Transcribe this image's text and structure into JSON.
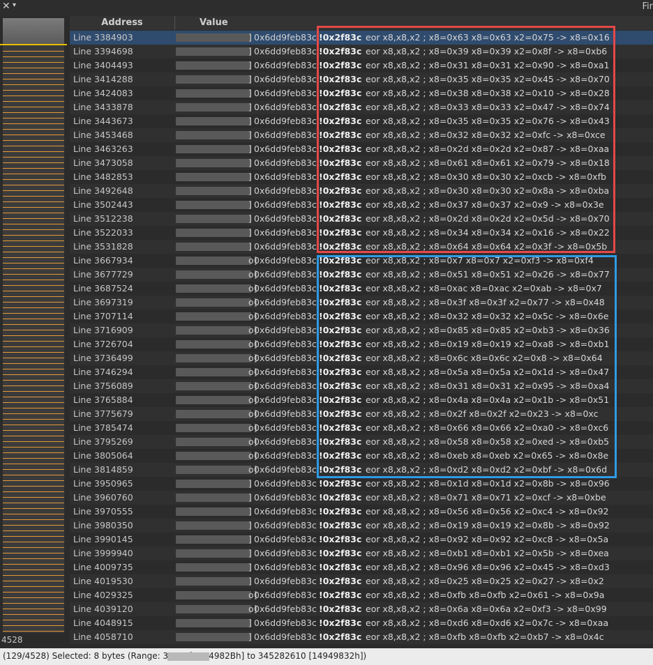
{
  "topbar": {
    "close_icon": "✕",
    "menu_icon": "▾",
    "find_label": "Fir"
  },
  "minimap": {
    "count": "4528"
  },
  "headers": {
    "address": "Address",
    "value": "Value"
  },
  "rows": [
    {
      "line": "Line 3384903",
      "sep": "]",
      "addr": "0x6dd9feb83c",
      "off": "!0x2f83c",
      "op": "eor x8,x8,x2 ; x8=0x63 x8=0x63 x2=0x75 -> x8=0x16"
    },
    {
      "line": "Line 3394698",
      "sep": "]",
      "addr": "0x6dd9feb83c",
      "off": "!0x2f83c",
      "op": "eor x8,x8,x2 ; x8=0x39 x8=0x39 x2=0x8f -> x8=0xb6"
    },
    {
      "line": "Line 3404493",
      "sep": "]",
      "addr": "0x6dd9feb83c",
      "off": "!0x2f83c",
      "op": "eor x8,x8,x2 ; x8=0x31 x8=0x31 x2=0x90 -> x8=0xa1"
    },
    {
      "line": "Line 3414288",
      "sep": "]",
      "addr": "0x6dd9feb83c",
      "off": "!0x2f83c",
      "op": "eor x8,x8,x2 ; x8=0x35 x8=0x35 x2=0x45 -> x8=0x70"
    },
    {
      "line": "Line 3424083",
      "sep": "]",
      "addr": "0x6dd9feb83c",
      "off": "!0x2f83c",
      "op": "eor x8,x8,x2 ; x8=0x38 x8=0x38 x2=0x10 -> x8=0x28"
    },
    {
      "line": "Line 3433878",
      "sep": "]",
      "addr": "0x6dd9feb83c",
      "off": "!0x2f83c",
      "op": "eor x8,x8,x2 ; x8=0x33 x8=0x33 x2=0x47 -> x8=0x74"
    },
    {
      "line": "Line 3443673",
      "sep": "]",
      "addr": "0x6dd9feb83c",
      "off": "!0x2f83c",
      "op": "eor x8,x8,x2 ; x8=0x35 x8=0x35 x2=0x76 -> x8=0x43"
    },
    {
      "line": "Line 3453468",
      "sep": "]",
      "addr": "0x6dd9feb83c",
      "off": "!0x2f83c",
      "op": "eor x8,x8,x2 ; x8=0x32 x8=0x32 x2=0xfc -> x8=0xce"
    },
    {
      "line": "Line 3463263",
      "sep": "]",
      "addr": "0x6dd9feb83c",
      "off": "!0x2f83c",
      "op": "eor x8,x8,x2 ; x8=0x2d x8=0x2d x2=0x87 -> x8=0xaa"
    },
    {
      "line": "Line 3473058",
      "sep": "]",
      "addr": "0x6dd9feb83c",
      "off": "!0x2f83c",
      "op": "eor x8,x8,x2 ; x8=0x61 x8=0x61 x2=0x79 -> x8=0x18"
    },
    {
      "line": "Line 3482853",
      "sep": "]",
      "addr": "0x6dd9feb83c",
      "off": "!0x2f83c",
      "op": "eor x8,x8,x2 ; x8=0x30 x8=0x30 x2=0xcb -> x8=0xfb"
    },
    {
      "line": "Line 3492648",
      "sep": "]",
      "addr": "0x6dd9feb83c",
      "off": "!0x2f83c",
      "op": "eor x8,x8,x2 ; x8=0x30 x8=0x30 x2=0x8a -> x8=0xba"
    },
    {
      "line": "Line 3502443",
      "sep": "]",
      "addr": "0x6dd9feb83c",
      "off": "!0x2f83c",
      "op": "eor x8,x8,x2 ; x8=0x37 x8=0x37 x2=0x9 -> x8=0x3e"
    },
    {
      "line": "Line 3512238",
      "sep": "]",
      "addr": "0x6dd9feb83c",
      "off": "!0x2f83c",
      "op": "eor x8,x8,x2 ; x8=0x2d x8=0x2d x2=0x5d -> x8=0x70"
    },
    {
      "line": "Line 3522033",
      "sep": "]",
      "addr": "0x6dd9feb83c",
      "off": "!0x2f83c",
      "op": "eor x8,x8,x2 ; x8=0x34 x8=0x34 x2=0x16 -> x8=0x22"
    },
    {
      "line": "Line 3531828",
      "sep": "]",
      "addr": "0x6dd9feb83c",
      "off": "!0x2f83c",
      "op": "eor x8,x8,x2 ; x8=0x64 x8=0x64 x2=0x3f -> x8=0x5b"
    },
    {
      "line": "Line 3667934",
      "sep": "o]",
      "addr": "0x6dd9feb83c",
      "off": "!0x2f83c",
      "op": "eor x8,x8,x2 ; x8=0x7 x8=0x7 x2=0xf3 -> x8=0xf4"
    },
    {
      "line": "Line 3677729",
      "sep": "o]",
      "addr": "0x6dd9feb83c",
      "off": "!0x2f83c",
      "op": "eor x8,x8,x2 ; x8=0x51 x8=0x51 x2=0x26 -> x8=0x77"
    },
    {
      "line": "Line 3687524",
      "sep": "o]",
      "addr": "0x6dd9feb83c",
      "off": "!0x2f83c",
      "op": "eor x8,x8,x2 ; x8=0xac x8=0xac x2=0xab -> x8=0x7"
    },
    {
      "line": "Line 3697319",
      "sep": "o]",
      "addr": "0x6dd9feb83c",
      "off": "!0x2f83c",
      "op": "eor x8,x8,x2 ; x8=0x3f x8=0x3f x2=0x77 -> x8=0x48"
    },
    {
      "line": "Line 3707114",
      "sep": "o]",
      "addr": "0x6dd9feb83c",
      "off": "!0x2f83c",
      "op": "eor x8,x8,x2 ; x8=0x32 x8=0x32 x2=0x5c -> x8=0x6e"
    },
    {
      "line": "Line 3716909",
      "sep": "o]",
      "addr": "0x6dd9feb83c",
      "off": "!0x2f83c",
      "op": "eor x8,x8,x2 ; x8=0x85 x8=0x85 x2=0xb3 -> x8=0x36"
    },
    {
      "line": "Line 3726704",
      "sep": "o]",
      "addr": "0x6dd9feb83c",
      "off": "!0x2f83c",
      "op": "eor x8,x8,x2 ; x8=0x19 x8=0x19 x2=0xa8 -> x8=0xb1"
    },
    {
      "line": "Line 3736499",
      "sep": "o]",
      "addr": "0x6dd9feb83c",
      "off": "!0x2f83c",
      "op": "eor x8,x8,x2 ; x8=0x6c x8=0x6c x2=0x8 -> x8=0x64"
    },
    {
      "line": "Line 3746294",
      "sep": "o]",
      "addr": "0x6dd9feb83c",
      "off": "!0x2f83c",
      "op": "eor x8,x8,x2 ; x8=0x5a x8=0x5a x2=0x1d -> x8=0x47"
    },
    {
      "line": "Line 3756089",
      "sep": "o]",
      "addr": "0x6dd9feb83c",
      "off": "!0x2f83c",
      "op": "eor x8,x8,x2 ; x8=0x31 x8=0x31 x2=0x95 -> x8=0xa4"
    },
    {
      "line": "Line 3765884",
      "sep": "o]",
      "addr": "0x6dd9feb83c",
      "off": "!0x2f83c",
      "op": "eor x8,x8,x2 ; x8=0x4a x8=0x4a x2=0x1b -> x8=0x51"
    },
    {
      "line": "Line 3775679",
      "sep": "o]",
      "addr": "0x6dd9feb83c",
      "off": "!0x2f83c",
      "op": "eor x8,x8,x2 ; x8=0x2f x8=0x2f x2=0x23 -> x8=0xc"
    },
    {
      "line": "Line 3785474",
      "sep": "o]",
      "addr": "0x6dd9feb83c",
      "off": "!0x2f83c",
      "op": "eor x8,x8,x2 ; x8=0x66 x8=0x66 x2=0xa0 -> x8=0xc6"
    },
    {
      "line": "Line 3795269",
      "sep": "o]",
      "addr": "0x6dd9feb83c",
      "off": "!0x2f83c",
      "op": "eor x8,x8,x2 ; x8=0x58 x8=0x58 x2=0xed -> x8=0xb5"
    },
    {
      "line": "Line 3805064",
      "sep": "o]",
      "addr": "0x6dd9feb83c",
      "off": "!0x2f83c",
      "op": "eor x8,x8,x2 ; x8=0xeb x8=0xeb x2=0x65 -> x8=0x8e"
    },
    {
      "line": "Line 3814859",
      "sep": "o]",
      "addr": "0x6dd9feb83c",
      "off": "!0x2f83c",
      "op": "eor x8,x8,x2 ; x8=0xd2 x8=0xd2 x2=0xbf -> x8=0x6d"
    },
    {
      "line": "Line 3950965",
      "sep": "]",
      "addr": "0x6dd9feb83c",
      "off": "!0x2f83c",
      "op": "eor x8,x8,x2 ; x8=0x1d x8=0x1d x2=0x8b -> x8=0x96"
    },
    {
      "line": "Line 3960760",
      "sep": "]",
      "addr": "0x6dd9feb83c",
      "off": "!0x2f83c",
      "op": "eor x8,x8,x2 ; x8=0x71 x8=0x71 x2=0xcf -> x8=0xbe"
    },
    {
      "line": "Line 3970555",
      "sep": "]",
      "addr": "0x6dd9feb83c",
      "off": "!0x2f83c",
      "op": "eor x8,x8,x2 ; x8=0x56 x8=0x56 x2=0xc4 -> x8=0x92"
    },
    {
      "line": "Line 3980350",
      "sep": "]",
      "addr": "0x6dd9feb83c",
      "off": "!0x2f83c",
      "op": "eor x8,x8,x2 ; x8=0x19 x8=0x19 x2=0x8b -> x8=0x92"
    },
    {
      "line": "Line 3990145",
      "sep": "]",
      "addr": "0x6dd9feb83c",
      "off": "!0x2f83c",
      "op": "eor x8,x8,x2 ; x8=0x92 x8=0x92 x2=0xc8 -> x8=0x5a"
    },
    {
      "line": "Line 3999940",
      "sep": "]",
      "addr": "0x6dd9feb83c",
      "off": "!0x2f83c",
      "op": "eor x8,x8,x2 ; x8=0xb1 x8=0xb1 x2=0x5b -> x8=0xea"
    },
    {
      "line": "Line 4009735",
      "sep": "]",
      "addr": "0x6dd9feb83c",
      "off": "!0x2f83c",
      "op": "eor x8,x8,x2 ; x8=0x96 x8=0x96 x2=0x45 -> x8=0xd3"
    },
    {
      "line": "Line 4019530",
      "sep": "]",
      "addr": "0x6dd9feb83c",
      "off": "!0x2f83c",
      "op": "eor x8,x8,x2 ; x8=0x25 x8=0x25 x2=0x27 -> x8=0x2"
    },
    {
      "line": "Line 4029325",
      "sep": "o]",
      "addr": "0x6dd9feb83c",
      "off": "!0x2f83c",
      "op": "eor x8,x8,x2 ; x8=0xfb x8=0xfb x2=0x61 -> x8=0x9a"
    },
    {
      "line": "Line 4039120",
      "sep": "o]",
      "addr": "0x6dd9feb83c",
      "off": "!0x2f83c",
      "op": "eor x8,x8,x2 ; x8=0x6a x8=0x6a x2=0xf3 -> x8=0x99"
    },
    {
      "line": "Line 4048915",
      "sep": "]",
      "addr": "0x6dd9feb83c",
      "off": "!0x2f83c",
      "op": "eor x8,x8,x2 ; x8=0xd6 x8=0xd6 x2=0x7c -> x8=0xaa"
    },
    {
      "line": "Line 4058710",
      "sep": "]",
      "addr": "0x6dd9feb83c",
      "off": "!0x2f83c",
      "op": "eor x8,x8,x2 ; x8=0xfb x8=0xfb x2=0xb7 -> x8=0x4c"
    }
  ],
  "status": {
    "text": "(129/4528) Selected: 8 bytes (Range: 34        03 [1494982Bh] to 345282610 [14949832h])"
  },
  "colors": {
    "highlight_red": "#e54848",
    "highlight_blue": "#2e9be6",
    "minimap_marker": "#e4983a",
    "selection": "#2f4b6e"
  }
}
